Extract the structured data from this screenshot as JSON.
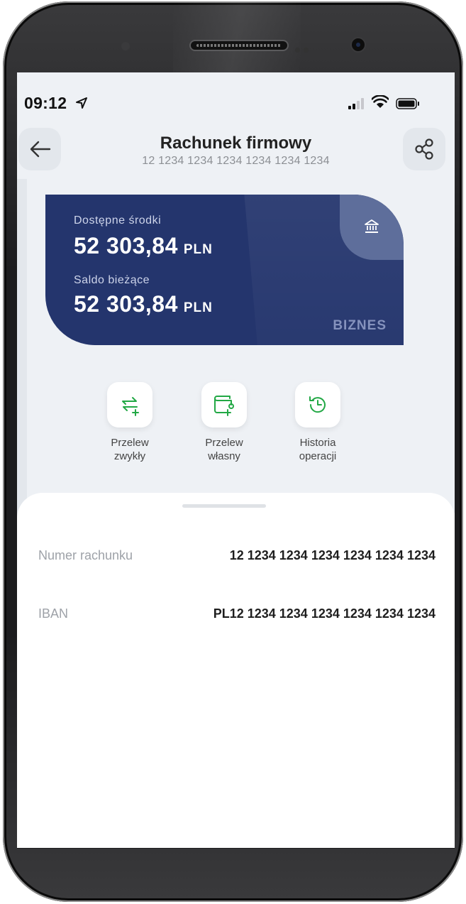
{
  "status_bar": {
    "time": "09:12"
  },
  "header": {
    "title": "Rachunek firmowy",
    "subtitle": "12 1234 1234 1234 1234 1234 1234"
  },
  "card": {
    "available_label": "Dostępne środki",
    "available_amount": "52 303,84",
    "available_currency": "PLN",
    "balance_label": "Saldo bieżące",
    "balance_amount": "52 303,84",
    "balance_currency": "PLN",
    "badge": "BIZNES",
    "color": "#24356d"
  },
  "actions": [
    {
      "line1": "Przelew",
      "line2": "zwykły",
      "icon": "transfer-arrows-plus-icon"
    },
    {
      "line1": "Przelew",
      "line2": "własny",
      "icon": "wallet-plus-icon"
    },
    {
      "line1": "Historia",
      "line2": "operacji",
      "icon": "history-clock-icon"
    }
  ],
  "details": {
    "account_number_label": "Numer rachunku",
    "account_number_value": "12 1234 1234 1234 1234 1234 1234",
    "iban_label": "IBAN",
    "iban_value": "PL12 1234 1234 1234 1234 1234 1234"
  },
  "colors": {
    "accent": "#22a845",
    "background": "#eef1f5"
  }
}
